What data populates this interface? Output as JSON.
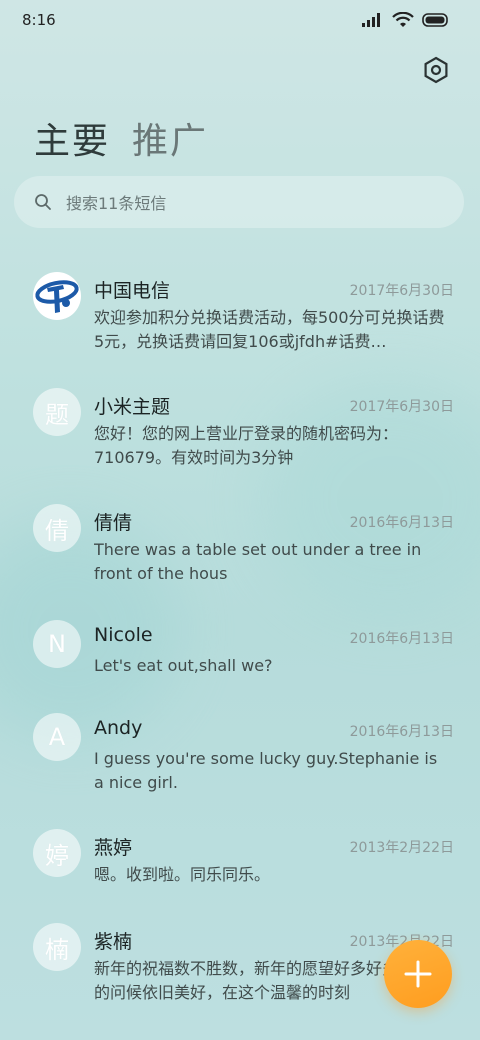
{
  "status": {
    "time": "8:16"
  },
  "tabs": [
    {
      "label": "主要",
      "active": true
    },
    {
      "label": "推广",
      "active": false
    }
  ],
  "search": {
    "placeholder": "搜索11条短信"
  },
  "colors": {
    "fab": "#ff9f22",
    "accent_logo": "#1c5aa8"
  },
  "conversations": [
    {
      "avatar": "",
      "avatar_icon": "china-telecom-logo-icon",
      "name": "中国电信",
      "date": "2017年6月30日",
      "preview": "欢迎参加积分兑换话费活动，每500分可兑换话费5元，兑换话费请回复106或jfdh#话费…"
    },
    {
      "avatar": "题",
      "name": "小米主题",
      "date": "2017年6月30日",
      "preview": "您好！您的网上营业厅登录的随机密码为：710679。有效时间为3分钟"
    },
    {
      "avatar": "倩",
      "name": "倩倩",
      "date": "2016年6月13日",
      "preview": "There was a table set out under a tree in front of the hous"
    },
    {
      "avatar": "N",
      "name": "Nicole",
      "date": "2016年6月13日",
      "preview": "Let's eat out,shall we?"
    },
    {
      "avatar": "A",
      "name": "Andy",
      "date": "2016年6月13日",
      "preview": "I guess you're some lucky guy.Stephanie is a nice girl."
    },
    {
      "avatar": "婷",
      "name": "燕婷",
      "date": "2013年2月22日",
      "preview": "嗯。收到啦。同乐同乐。"
    },
    {
      "avatar": "楠",
      "name": "紫楠",
      "date": "2013年2月22日",
      "preview": "新年的祝福数不胜数，新年的愿望好多好多，新年的问候依旧美好，在这个温馨的时刻"
    }
  ]
}
